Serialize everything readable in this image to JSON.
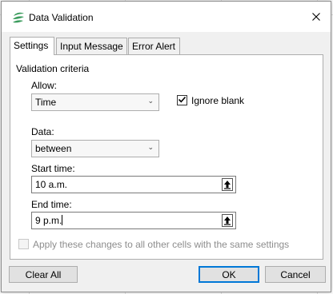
{
  "window": {
    "title": "Data Validation"
  },
  "tabs": [
    {
      "label": "Settings",
      "active": true
    },
    {
      "label": "Input Message",
      "active": false
    },
    {
      "label": "Error Alert",
      "active": false
    }
  ],
  "settings": {
    "section_label": "Validation criteria",
    "allow_label": "Allow:",
    "allow_value": "Time",
    "ignore_blank_label": "Ignore blank",
    "ignore_blank_checked": true,
    "data_label": "Data:",
    "data_value": "between",
    "start_time_label": "Start time:",
    "start_time_value": "10 a.m.",
    "end_time_label": "End time:",
    "end_time_value": "9 p.m.",
    "apply_all_label": "Apply these changes to all other cells with the same settings",
    "apply_all_checked": false
  },
  "buttons": {
    "clear_all": "Clear All",
    "ok": "OK",
    "cancel": "Cancel"
  },
  "icons": {
    "app": "spreadsheet-logo-icon",
    "close": "close-icon",
    "dropdown": "chevron-down-icon",
    "check": "checkmark-icon",
    "range_select": "range-select-icon"
  },
  "colors": {
    "accent": "#0078d7",
    "logo_green": "#3a9b5c",
    "disabled_text": "#8d8d8d"
  }
}
